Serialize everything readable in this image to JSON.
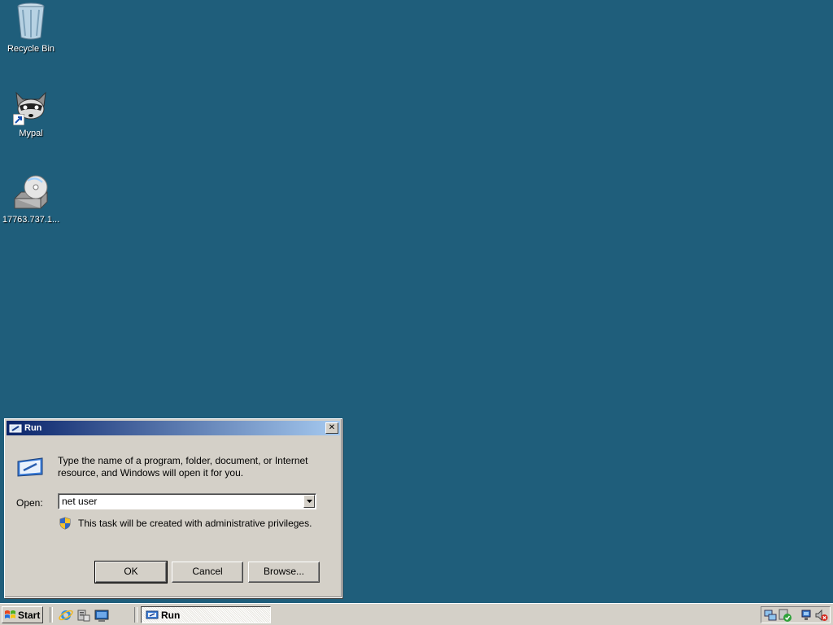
{
  "desktop": {
    "icons": [
      {
        "label": "Recycle Bin",
        "icon": "recycle-bin-icon"
      },
      {
        "label": "Mypal",
        "icon": "raccoon-app-icon"
      },
      {
        "label": "17763.737.1...",
        "icon": "dvd-drive-icon"
      }
    ],
    "background_color": "#1f5e7b"
  },
  "run_dialog": {
    "title": "Run",
    "description": "Type the name of a program, folder, document, or Internet resource, and Windows will open it for you.",
    "open_label": "Open:",
    "open_value": "net user",
    "admin_note": "This task will be created with administrative privileges.",
    "buttons": {
      "ok": "OK",
      "cancel": "Cancel",
      "browse": "Browse..."
    }
  },
  "taskbar": {
    "start_label": "Start",
    "quick_launch": [
      "internet-explorer-icon",
      "server-manager-icon",
      "show-desktop-icon"
    ],
    "tasks": [
      {
        "label": "Run",
        "icon": "run-icon"
      }
    ],
    "tray": [
      "network-icon",
      "security-shield-icon",
      "network-disconnected-icon",
      "volume-muted-icon"
    ]
  }
}
